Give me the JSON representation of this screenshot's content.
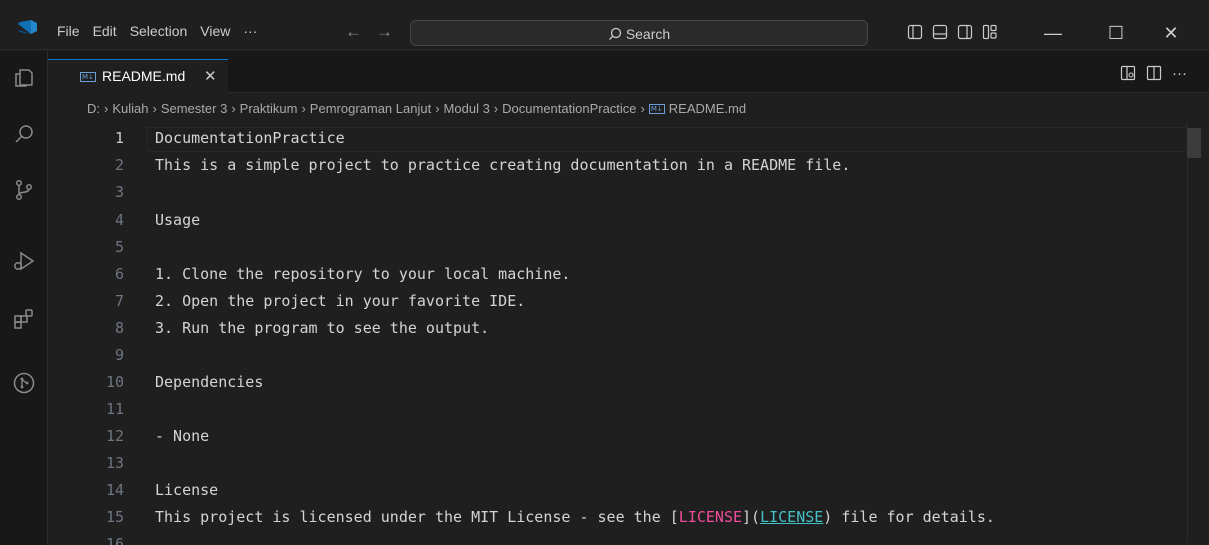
{
  "menu": {
    "items": [
      "File",
      "Edit",
      "Selection",
      "View",
      "···"
    ],
    "back_arrow": "←",
    "forward_arrow": "→"
  },
  "search": {
    "label": "Search"
  },
  "window_controls": {
    "minimize": "—",
    "maximize": "☐",
    "close": "✕"
  },
  "tab": {
    "icon_text": "M↓",
    "name": "README.md",
    "close": "✕"
  },
  "tab_actions": {
    "more": "···"
  },
  "breadcrumb": [
    "D:",
    "Kuliah",
    "Semester 3",
    "Praktikum",
    "Pemrograman Lanjut",
    "Modul 3",
    "DocumentationPractice",
    "README.md"
  ],
  "editor": {
    "current_line": 1,
    "lines": [
      {
        "n": "1",
        "text": "DocumentationPractice"
      },
      {
        "n": "2",
        "text": "This is a simple project to practice creating documentation in a README file."
      },
      {
        "n": "3",
        "text": ""
      },
      {
        "n": "4",
        "text": "Usage"
      },
      {
        "n": "5",
        "text": ""
      },
      {
        "n": "6",
        "text": "1. Clone the repository to your local machine."
      },
      {
        "n": "7",
        "text": "2. Open the project in your favorite IDE."
      },
      {
        "n": "8",
        "text": "3. Run the program to see the output."
      },
      {
        "n": "9",
        "text": ""
      },
      {
        "n": "10",
        "text": "Dependencies"
      },
      {
        "n": "11",
        "text": ""
      },
      {
        "n": "12",
        "text": "- None"
      },
      {
        "n": "13",
        "text": ""
      },
      {
        "n": "14",
        "text": "License"
      },
      {
        "n": "15",
        "text": "This project is licensed under the MIT License - see the "
      },
      {
        "n": "16",
        "text": ""
      }
    ],
    "license_line": {
      "prefix": "This project is licensed under the MIT License - see the ",
      "open_bracket": "[",
      "link_text": "LICENSE",
      "close_bracket_paren": "](",
      "link_target": "LICENSE",
      "suffix": ") file for details."
    }
  },
  "colors": {
    "accent": "#0078d4",
    "link_text": "#f14c9c",
    "link_target": "#44c0c7",
    "editor_bg": "#1f1f1f"
  }
}
